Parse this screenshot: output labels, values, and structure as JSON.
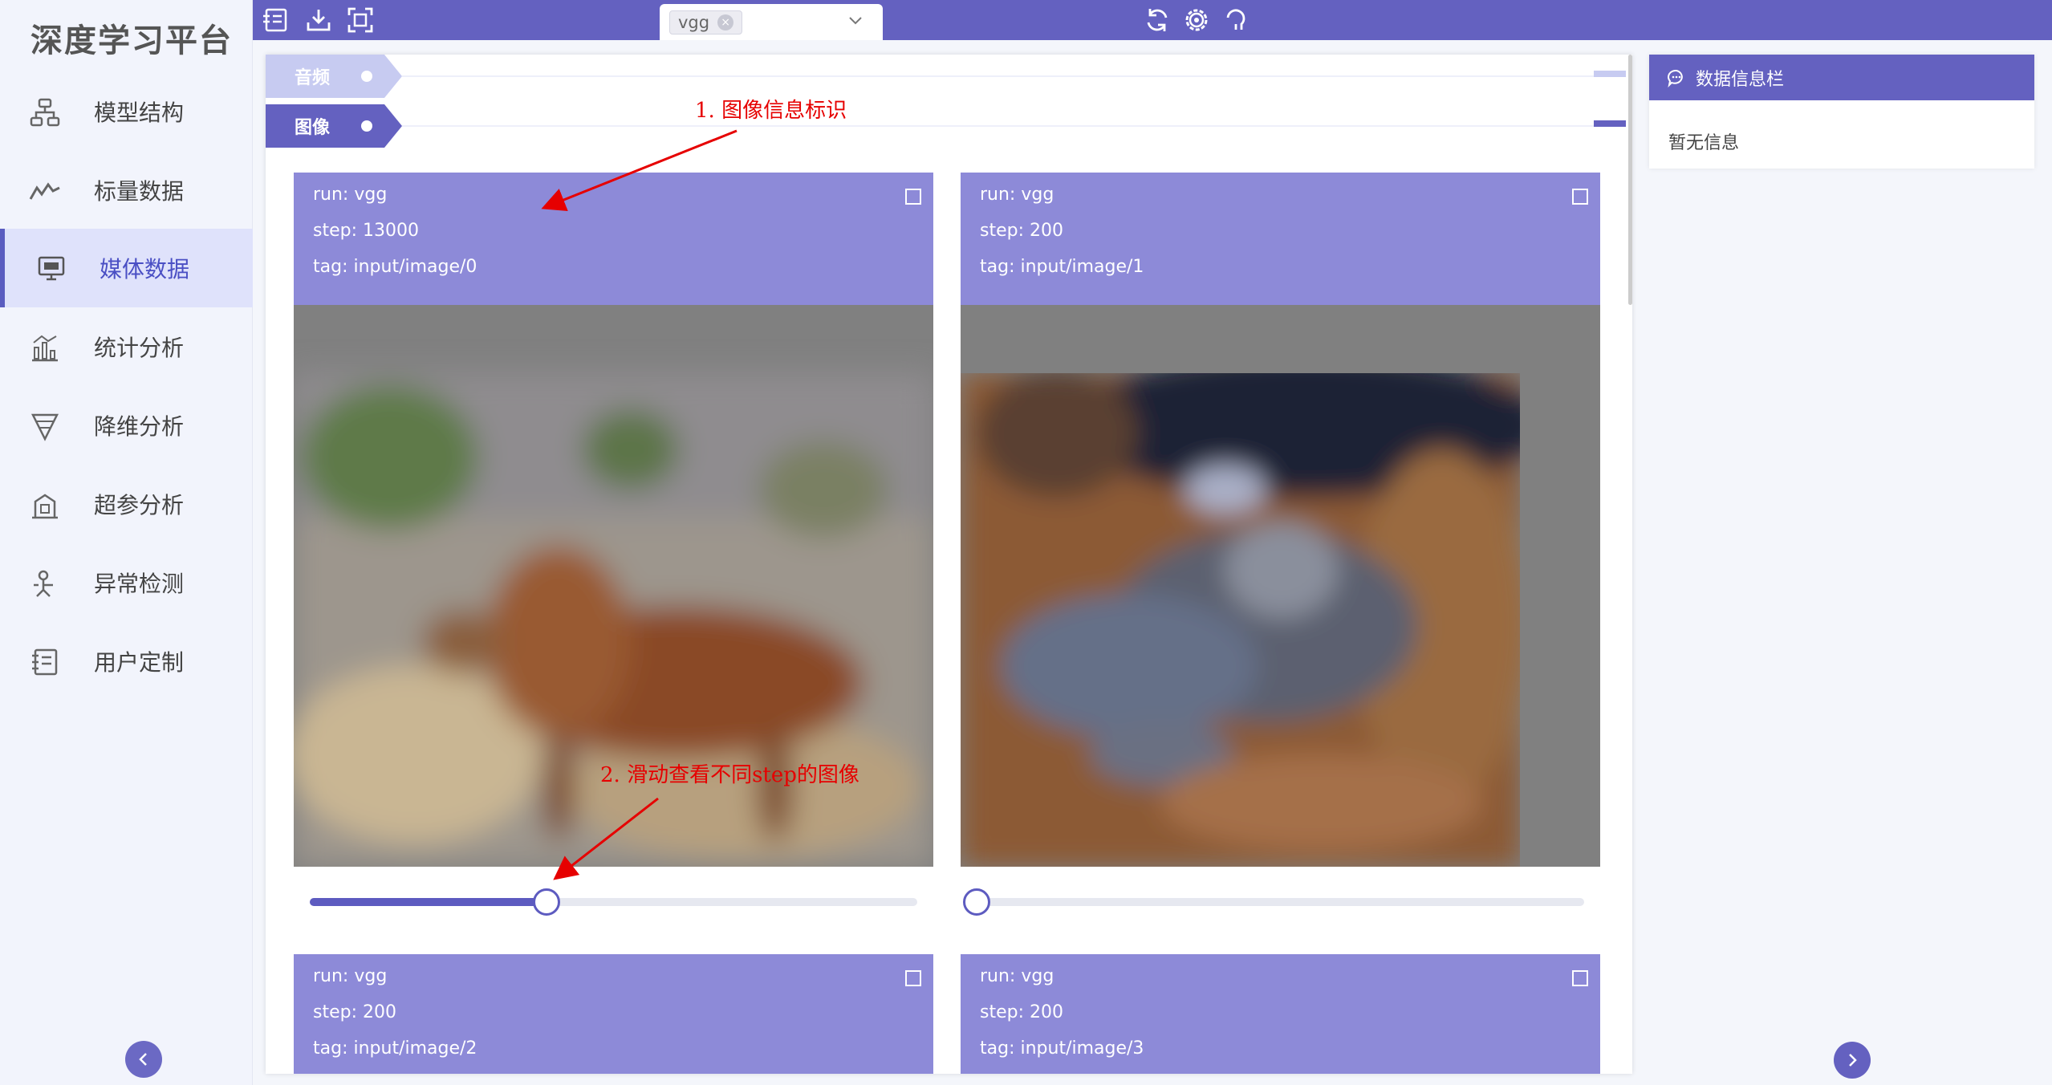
{
  "app": {
    "title": "深度学习平台"
  },
  "sidebar": {
    "items": [
      {
        "label": "模型结构",
        "icon": "model-structure-icon"
      },
      {
        "label": "标量数据",
        "icon": "scalar-line-icon"
      },
      {
        "label": "媒体数据",
        "icon": "media-monitor-icon",
        "active": true
      },
      {
        "label": "统计分析",
        "icon": "statistics-icon"
      },
      {
        "label": "降维分析",
        "icon": "dimension-reduction-icon"
      },
      {
        "label": "超参分析",
        "icon": "hyperparam-icon"
      },
      {
        "label": "异常检测",
        "icon": "anomaly-icon"
      },
      {
        "label": "用户定制",
        "icon": "custom-icon"
      }
    ]
  },
  "topbar": {
    "run_tag": "vgg",
    "right_icons": [
      "refresh-icon",
      "settings-icon",
      "help-icon"
    ]
  },
  "categories": [
    {
      "label": "音频",
      "active": false
    },
    {
      "label": "图像",
      "active": true
    }
  ],
  "cards": [
    {
      "run": "run: vgg",
      "step": "step: 13000",
      "tag": "tag: input/image/0",
      "slider": 0.39,
      "image": "deer"
    },
    {
      "run": "run: vgg",
      "step": "step: 200",
      "tag": "tag: input/image/1",
      "slider": 0.0,
      "image": "cat"
    },
    {
      "run": "run: vgg",
      "step": "step: 200",
      "tag": "tag: input/image/2"
    },
    {
      "run": "run: vgg",
      "step": "step: 200",
      "tag": "tag: input/image/3"
    }
  ],
  "info_panel": {
    "title": "数据信息栏",
    "empty_text": "暂无信息"
  },
  "annotations": {
    "first": "1. 图像信息标识",
    "second": "2. 滑动查看不同step的图像"
  },
  "colors": {
    "primary": "#6461c0",
    "card_header": "#8d8ad8",
    "sidebar_active": "#dfe2fb",
    "annotation": "#e60000"
  }
}
